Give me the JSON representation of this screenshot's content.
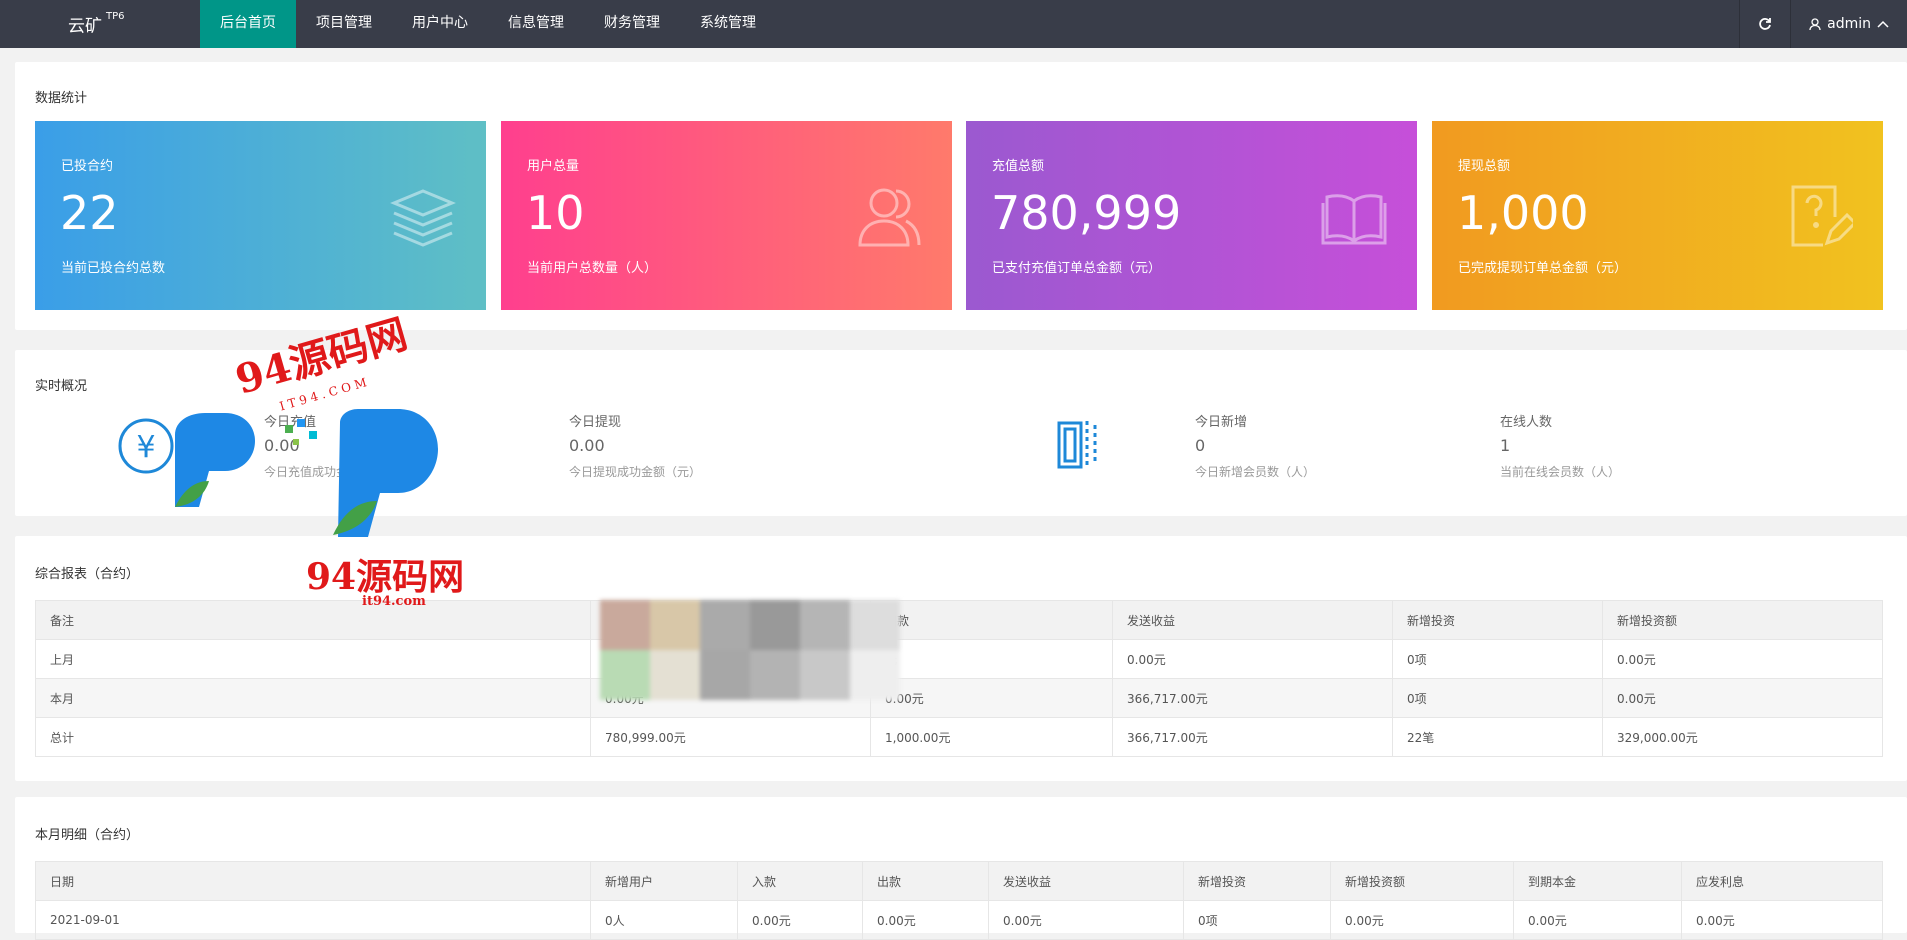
{
  "topbar": {
    "logo": "云矿",
    "logo_sup": "TP6",
    "nav": [
      "后台首页",
      "项目管理",
      "用户中心",
      "信息管理",
      "财务管理",
      "系统管理"
    ],
    "user": "admin"
  },
  "stats_section": {
    "title": "数据统计",
    "cards": [
      {
        "label": "已投合约",
        "value": "22",
        "sub": "当前已投合约总数",
        "icon": "layers-icon"
      },
      {
        "label": "用户总量",
        "value": "10",
        "sub": "当前用户总数量（人）",
        "icon": "users-icon"
      },
      {
        "label": "充值总额",
        "value": "780,999",
        "sub": "已支付充值订单总金额（元）",
        "icon": "book-icon"
      },
      {
        "label": "提现总额",
        "value": "1,000",
        "sub": "已完成提现订单总金额（元）",
        "icon": "question-edit-icon"
      }
    ]
  },
  "realtime": {
    "title": "实时概况",
    "items": [
      {
        "label": "今日充值",
        "value": "0.00",
        "sub": "今日充值成功金额（元）"
      },
      {
        "label": "今日提现",
        "value": "0.00",
        "sub": "今日提现成功金额（元）"
      },
      {
        "label": "今日新增",
        "value": "0",
        "sub": "今日新增会员数（人）"
      },
      {
        "label": "在线人数",
        "value": "1",
        "sub": "当前在线会员数（人）"
      }
    ]
  },
  "report": {
    "title": "综合报表（合约）",
    "headers": [
      "备注",
      "",
      "出款",
      "发送收益",
      "新增投资",
      "新增投资额"
    ],
    "rows": [
      [
        "上月",
        "",
        "元",
        "0.00元",
        "0项",
        "0.00元"
      ],
      [
        "本月",
        "0.00元",
        "0.00元",
        "366,717.00元",
        "0项",
        "0.00元"
      ],
      [
        "总计",
        "780,999.00元",
        "1,000.00元",
        "366,717.00元",
        "22笔",
        "329,000.00元"
      ]
    ]
  },
  "detail": {
    "title": "本月明细（合约）",
    "headers": [
      "日期",
      "新增用户",
      "入款",
      "出款",
      "发送收益",
      "新增投资",
      "新增投资额",
      "到期本金",
      "应发利息"
    ],
    "rows": [
      [
        "2021-09-01",
        "0人",
        "0.00元",
        "0.00元",
        "0.00元",
        "0项",
        "0.00元",
        "0.00元",
        "0.00元"
      ]
    ]
  },
  "watermark": {
    "text1": "94源码网",
    "text1_sub": "I T 9 4 . C O M",
    "text2": "94源码网",
    "text2_sub": "it94.com"
  },
  "colors": {
    "card1": [
      "#3a9ee8",
      "#5fbfc5"
    ],
    "card2": [
      "#ff3f8e",
      "#ff7a6b"
    ],
    "card3": [
      "#9b59d0",
      "#c64fd9"
    ],
    "card4": [
      "#f19a20",
      "#f1c21f"
    ],
    "nav_active": "#009688",
    "topbar": "#393d49"
  }
}
